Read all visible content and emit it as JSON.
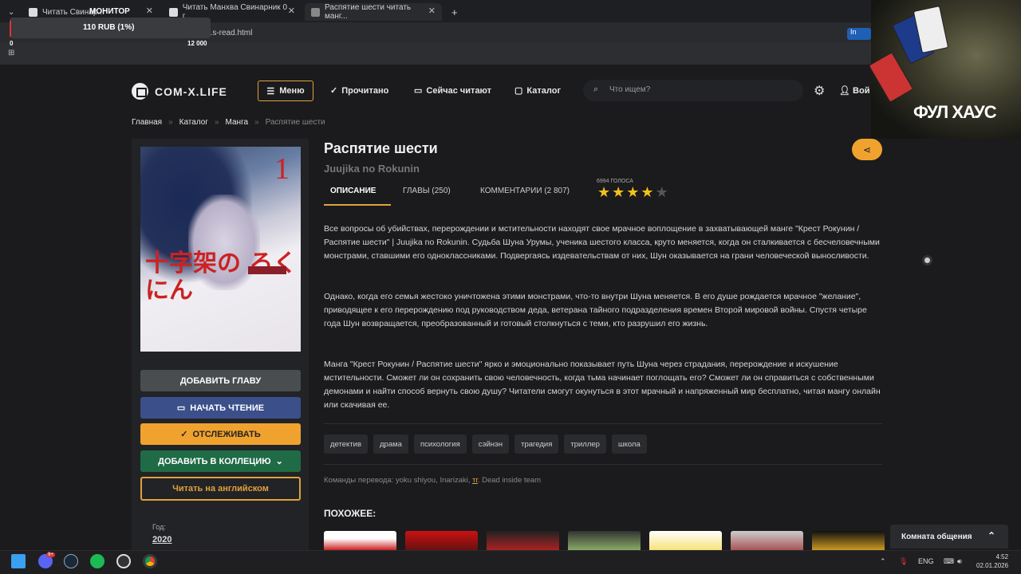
{
  "browser": {
    "tabs": [
      {
        "label": "Читать Свинар..."
      },
      {
        "label": "Читать Манхва Свинарник 0 г..."
      },
      {
        "label": "Распятие шести читать манг..."
      }
    ],
    "url": "...s-read.html",
    "info_button": "In"
  },
  "overlay": {
    "title": "МОНИТОР",
    "price": "110 RUB (1%)",
    "min": "0",
    "max": "12 000"
  },
  "site": {
    "logo": "COM-X.LIFE",
    "menu": "Меню",
    "nav": [
      "Прочитано",
      "Сейчас читают",
      "Каталог"
    ],
    "search_placeholder": "Что ищем?",
    "login": "Вой"
  },
  "breadcrumb": [
    "Главная",
    "Каталог",
    "Манга",
    "Распятие шести"
  ],
  "manga": {
    "title": "Распятие шести",
    "alt_title": "Juujika no Rokunin",
    "tabs": [
      "ОПИСАНИЕ",
      "ГЛАВЫ (250)",
      "КОММЕНТАРИИ (2 807)"
    ],
    "votes": "6994 ГОЛОСА",
    "rating": 4,
    "rating_max": 5,
    "cover_number": "1",
    "cover_title": "十字架の ろくにん",
    "description": [
      "Все вопросы об убийствах, перерождении и мстительности находят свое мрачное воплощение в захватывающей манге \"Крест Рокунин / Распятие шести\" | Juujika no Rokunin. Судьба Шуна Урумы, ученика шестого класса, круто меняется, когда он сталкивается с бесчеловечными монстрами, ставшими его одноклассниками. Подвергаясь издевательствам от них, Шун оказывается на грани человеческой выносливости.",
      "Однако, когда его семья жестоко уничтожена этими монстрами, что-то внутри Шуна меняется. В его душе рождается мрачное \"желание\", приводящее к его перерождению под руководством деда, ветерана тайного подразделения времен Второй мировой войны. Спустя четыре года Шун возвращается, преобразованный и готовый столкнуться с теми, кто разрушил его жизнь.",
      "Манга \"Крест Рокунин / Распятие шести\" ярко и эмоционально показывает путь Шуна через страдания, перерождение и искушение мстительности. Сможет ли он сохранить свою человечность, когда тьма начинает поглощать его? Сможет ли он справиться с собственными демонами и найти способ вернуть свою душу? Читатели смогут окунуться в этот мрачный и напряженный мир бесплатно, читая мангу онлайн или скачивая ее."
    ],
    "tags": [
      "детектив",
      "драма",
      "психология",
      "сэйнэн",
      "трагедия",
      "триллер",
      "школа"
    ],
    "teams_label": "Команды перевода:",
    "teams_list": "yoku shiyou, Inarizaki,",
    "teams_link": "тг",
    "teams_rest": "Dead inside team",
    "similar_title": "ПОХОЖЕЕ:"
  },
  "sidebar": {
    "buttons": [
      "ДОБАВИТЬ ГЛАВУ",
      "НАЧАТЬ ЧТЕНИЕ",
      "ОТСЛЕЖИВАТЬ",
      "ДОБАВИТЬ В КОЛЛЕЦИЮ",
      "Читать на английском"
    ],
    "year_label": "Год:",
    "year": "2020"
  },
  "chat": {
    "label": "Комната общения"
  },
  "stream_overlay": {
    "text": "ФУЛ ХАУС"
  },
  "taskbar": {
    "lang": "ENG",
    "time": "4:52",
    "date": "02.01.2026",
    "discord_badge": "9+"
  },
  "colors": {
    "accent": "#e0a23c",
    "btn_gray": "#4a4d50",
    "btn_blue": "#3b4f8a",
    "btn_orange": "#f0a22f",
    "btn_green": "#1f6b45",
    "star": "#f2c21b"
  }
}
